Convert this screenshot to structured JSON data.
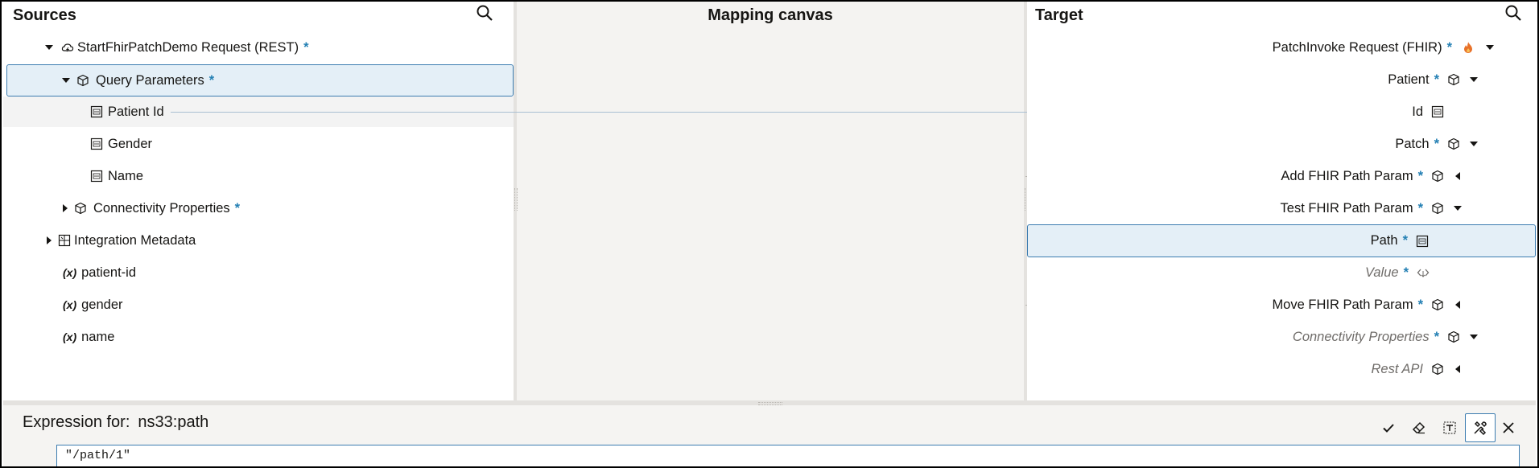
{
  "sources": {
    "title": "Sources",
    "required_mark": "*",
    "rows": [
      {
        "label": "StartFhirPatchDemo Request (REST)",
        "required": true
      },
      {
        "label": "Query Parameters",
        "required": true
      },
      {
        "label": "Patient Id"
      },
      {
        "label": "Gender"
      },
      {
        "label": "Name"
      },
      {
        "label": "Connectivity Properties",
        "required": true
      },
      {
        "label": "Integration Metadata"
      },
      {
        "label": "patient-id",
        "prefix": "(x)"
      },
      {
        "label": "gender",
        "prefix": "(x)"
      },
      {
        "label": "name",
        "prefix": "(x)"
      }
    ]
  },
  "canvas": {
    "title": "Mapping canvas"
  },
  "target": {
    "title": "Target",
    "required_mark": "*",
    "rows": [
      {
        "label": "PatchInvoke Request (FHIR)",
        "required": true
      },
      {
        "label": "Patient",
        "required": true
      },
      {
        "label": "Id"
      },
      {
        "label": "Patch",
        "required": true
      },
      {
        "label": "Add FHIR Path Param",
        "required": true
      },
      {
        "label": "Test FHIR Path Param",
        "required": true
      },
      {
        "label": "Path",
        "required": true
      },
      {
        "label": "Value",
        "required": true
      },
      {
        "label": "Move FHIR Path Param",
        "required": true
      },
      {
        "label": "Connectivity Properties",
        "required": true
      },
      {
        "label": "Rest API"
      }
    ]
  },
  "expression": {
    "label": "Expression for:",
    "path": "ns33:path",
    "value": "\"/path/1\""
  },
  "colors": {
    "accent": "#227fb3",
    "selected_bg": "#e4eff7",
    "selected_border": "#3c7cb0",
    "fire": "#e8722a"
  }
}
